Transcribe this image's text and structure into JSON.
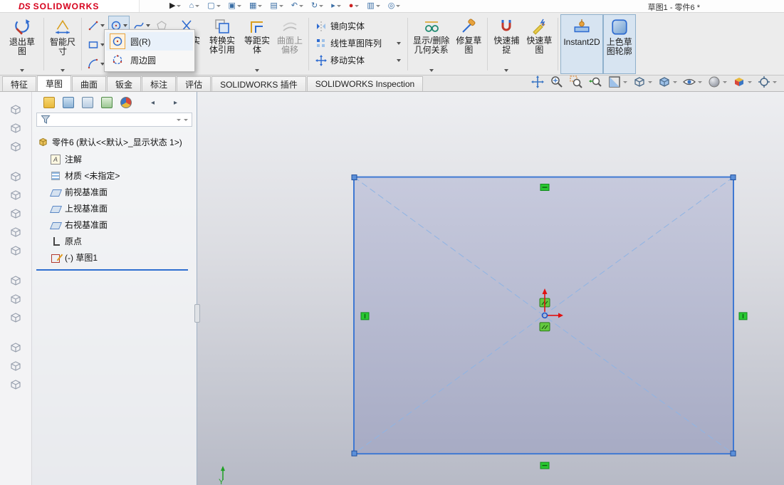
{
  "titlebar": {
    "logo_ds": "DS",
    "logo_sw": "SOLIDWORKS",
    "doc_title": "草图1 - 零件6 *",
    "icons": [
      {
        "name": "play-icon",
        "glyph": "▶"
      },
      {
        "name": "home-icon",
        "glyph": "⌂"
      },
      {
        "name": "new-document-icon",
        "glyph": "▢"
      },
      {
        "name": "open-document-icon",
        "glyph": "▣"
      },
      {
        "name": "save-icon",
        "glyph": "▦"
      },
      {
        "name": "print-icon",
        "glyph": "▤"
      },
      {
        "name": "undo-icon",
        "glyph": "↶"
      },
      {
        "name": "rebuild-icon",
        "glyph": "↻"
      },
      {
        "name": "select-arrow-icon",
        "glyph": "▸"
      },
      {
        "name": "pellet-icon",
        "glyph": "●"
      },
      {
        "name": "file-properties-icon",
        "glyph": "▥"
      },
      {
        "name": "options-gear-icon",
        "glyph": "◎"
      }
    ]
  },
  "ribbon": {
    "exit_sketch": "退出草\n图",
    "smart_dimension": "智能尺\n寸",
    "trim_entities": "剪裁实\n体",
    "convert_entities": "转换实\n体引用",
    "offset_entities": "等距实\n体",
    "offset_on_surface": "曲面上\n偏移",
    "mirror_entities": "镜向实体",
    "linear_sketch_pattern": "线性草图阵列",
    "move_entities": "移动实体",
    "display_delete_relations": "显示/删除\n几何关系",
    "repair_sketch": "修复草\n图",
    "quick_snaps": "快速捕\n捉",
    "rapid_sketch": "快速草\n图",
    "instant2d": "Instant2D",
    "shaded_sketch_contours": "上色草\n图轮廓"
  },
  "circle_menu": {
    "items": [
      {
        "name": "menu-item-circle",
        "label": "圆(R)",
        "state": "sel",
        "icon": "circle"
      },
      {
        "name": "menu-item-perimeter-circle",
        "label": "周边圆",
        "icon": "perimeter"
      }
    ]
  },
  "tabs": [
    {
      "name": "tab-features",
      "label": "特征"
    },
    {
      "name": "tab-sketch",
      "label": "草图",
      "state": "active"
    },
    {
      "name": "tab-surfaces",
      "label": "曲面"
    },
    {
      "name": "tab-sheet-metal",
      "label": "钣金"
    },
    {
      "name": "tab-markup",
      "label": "标注"
    },
    {
      "name": "tab-evaluate",
      "label": "评估"
    },
    {
      "name": "tab-solidworks-addins",
      "label": "SOLIDWORKS 插件"
    },
    {
      "name": "tab-solidworks-inspection",
      "label": "SOLIDWORKS Inspection"
    }
  ],
  "headsup_icons": [
    "pan-icon",
    "zoom-fit-icon",
    "zoom-area-icon",
    "previous-view-icon",
    "section-view-icon",
    "view-orientation-icon",
    "display-style-icon",
    "hide-show-items-icon",
    "edit-appearance-icon",
    "apply-scene-icon",
    "view-settings-icon"
  ],
  "feature_tree": {
    "root": "零件6 (默认<<默认>_显示状态 1>)",
    "manager_tabs": [
      {
        "name": "featuremanager-tab-icon",
        "kind": "fm"
      },
      {
        "name": "propertymanager-tab-icon",
        "kind": "pm"
      },
      {
        "name": "configurationmanager-tab-icon",
        "kind": "cm"
      },
      {
        "name": "dimxpertmanager-tab-icon",
        "kind": "dx"
      },
      {
        "name": "displaymanager-tab-icon",
        "kind": "dm"
      },
      {
        "name": "scroll-tabs-left-icon",
        "kind": "ar",
        "glyph": "◂"
      },
      {
        "name": "scroll-tabs-right-icon",
        "kind": "ar",
        "glyph": "▸"
      }
    ],
    "items": [
      {
        "name": "tree-item-annotations",
        "icon": "annotations",
        "label": "注解"
      },
      {
        "name": "tree-item-material",
        "icon": "material",
        "label": "材质 <未指定>"
      },
      {
        "name": "tree-item-front-plane",
        "icon": "plane",
        "label": "前视基准面"
      },
      {
        "name": "tree-item-top-plane",
        "icon": "plane",
        "label": "上视基准面"
      },
      {
        "name": "tree-item-right-plane",
        "icon": "plane",
        "label": "右视基准面"
      },
      {
        "name": "tree-item-origin",
        "icon": "origin",
        "label": "原点"
      },
      {
        "name": "tree-item-sketch1",
        "icon": "sketch",
        "label": "(-) 草图1"
      }
    ]
  },
  "left_toolbar": {
    "icons": [
      {
        "name": "docked-tool-icon-1"
      },
      {
        "name": "docked-tool-icon-2"
      },
      {
        "name": "docked-tool-icon-3"
      },
      {
        "name": "docked-tool-icon-4",
        "gap": "gapped"
      },
      {
        "name": "docked-tool-icon-5"
      },
      {
        "name": "docked-tool-icon-6"
      },
      {
        "name": "docked-tool-icon-7"
      },
      {
        "name": "docked-tool-icon-8"
      },
      {
        "name": "docked-tool-icon-9",
        "gap": "gapped"
      },
      {
        "name": "docked-tool-icon-10"
      },
      {
        "name": "docked-tool-icon-11"
      },
      {
        "name": "docked-tool-icon-12",
        "gap": "gapped"
      },
      {
        "name": "docked-tool-icon-13"
      },
      {
        "name": "docked-tool-icon-14"
      }
    ]
  },
  "viewport": {
    "axis_label_y": "Y"
  }
}
